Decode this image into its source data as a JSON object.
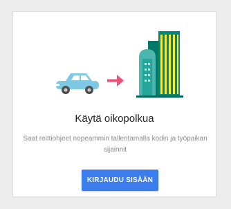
{
  "card": {
    "title": "Käytä oikopolkua",
    "subtitle": "Saat reittiohjeet nopeammin tallentamalla kodin ja työpaikan sijainnit",
    "signin_label": "KIRJAUDU SISÄÄN"
  },
  "illustration": {
    "icons": [
      "car-icon",
      "arrow-right-icon",
      "office-building-icon"
    ]
  },
  "colors": {
    "accent": "#3b7ded",
    "car": "#7ec8e3",
    "arrow": "#f0507a",
    "building_dark": "#00796b",
    "building_mid": "#26a69a",
    "building_light": "#4db6ac",
    "building_yellow": "#f5e63a"
  }
}
